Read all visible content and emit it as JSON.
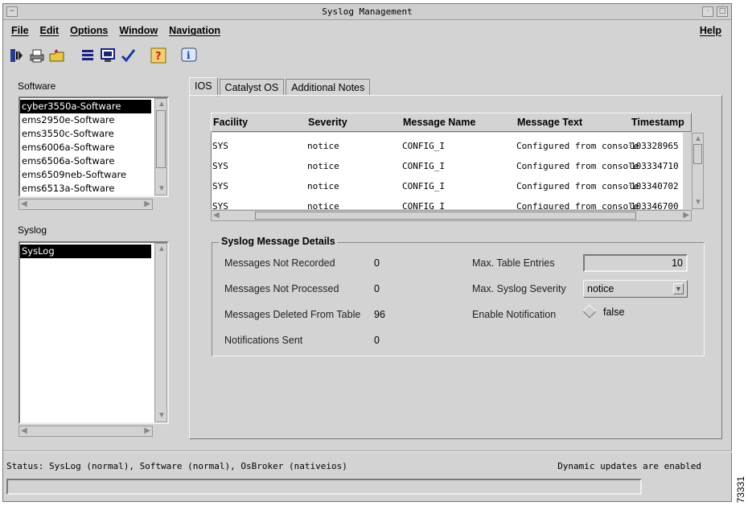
{
  "window": {
    "title": "Syslog Management"
  },
  "menu": {
    "file": "File",
    "edit": "Edit",
    "options": "Options",
    "window": "Window",
    "navigation": "Navigation",
    "help": "Help"
  },
  "toolbar": {
    "icons": [
      "exit-icon",
      "print-icon",
      "open-icon",
      "list-icon",
      "monitor-icon",
      "checkmark-icon",
      "help-icon",
      "info-icon"
    ]
  },
  "software": {
    "label": "Software",
    "items": [
      "cyber3550a-Software",
      "ems2950e-Software",
      "ems3550c-Software",
      "ems6006a-Software",
      "ems6506a-Software",
      "ems6509neb-Software",
      "ems6513a-Software"
    ],
    "selected": "cyber3550a-Software"
  },
  "syslog": {
    "label": "Syslog",
    "items": [
      "SysLog"
    ],
    "selected": "SysLog"
  },
  "tabs": [
    "IOS",
    "Catalyst OS",
    "Additional Notes"
  ],
  "table": {
    "headers": [
      "Facility",
      "Severity",
      "Message Name",
      "Message Text",
      "Timestamp"
    ],
    "rows": [
      [
        "SYS",
        "notice",
        "CONFIG_I",
        "Configured from console",
        "103328965"
      ],
      [
        "SYS",
        "notice",
        "CONFIG_I",
        "Configured from console",
        "103334710"
      ],
      [
        "SYS",
        "notice",
        "CONFIG_I",
        "Configured from console",
        "103340702"
      ],
      [
        "SYS",
        "notice",
        "CONFIG_I",
        "Configured from console",
        "103346700"
      ]
    ]
  },
  "details": {
    "title": "Syslog Message Details",
    "not_recorded_label": "Messages Not Recorded",
    "not_recorded": "0",
    "not_processed_label": "Messages Not Processed",
    "not_processed": "0",
    "deleted_label": "Messages Deleted From Table",
    "deleted": "96",
    "notifications_label": "Notifications Sent",
    "notifications": "0",
    "max_entries_label": "Max. Table Entries",
    "max_entries": "10",
    "max_severity_label": "Max. Syslog Severity",
    "max_severity": "notice",
    "enable_notification_label": "Enable Notification",
    "enable_notification": "false"
  },
  "status": {
    "left": "Status: SysLog (normal), Software (normal), OsBroker (nativeios)",
    "right": "Dynamic updates are enabled"
  },
  "figure_number": "73331"
}
